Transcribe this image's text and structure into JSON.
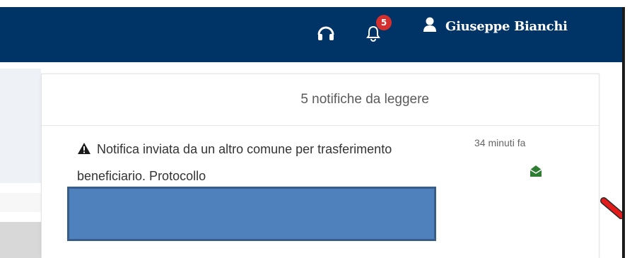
{
  "navbar": {
    "icons": [
      "headset-icon",
      "bell-icon",
      "user-icon"
    ],
    "notification_count": "5",
    "user_name": "Giuseppe Bianchi",
    "bg_color": "#003366"
  },
  "notifications": {
    "header": "5 notifiche da leggere",
    "items": [
      {
        "icon": "warning-icon",
        "text": "Notifica inviata da un altro comune per trasferimento beneficiario. Protocollo",
        "time": "34 minuti fa",
        "action_icon": "envelope-open-icon",
        "action_color": "#2e7d32"
      }
    ]
  },
  "colors": {
    "badge": "#d32f2f",
    "redaction_fill": "#4f81bd",
    "arrow": "#e31b1b"
  }
}
